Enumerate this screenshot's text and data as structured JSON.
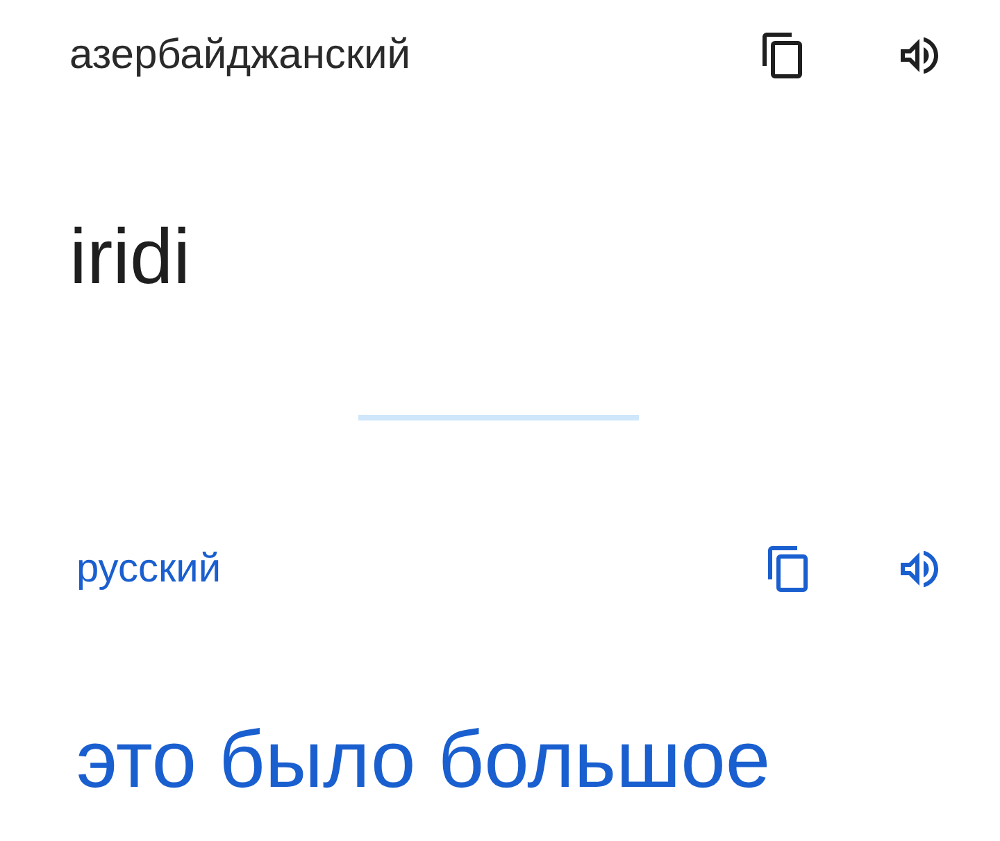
{
  "panels": [
    {
      "kind": "source",
      "language": "азербайджанский",
      "text": "iridi"
    },
    {
      "kind": "target",
      "language": "русский",
      "text": "это было большое"
    }
  ]
}
